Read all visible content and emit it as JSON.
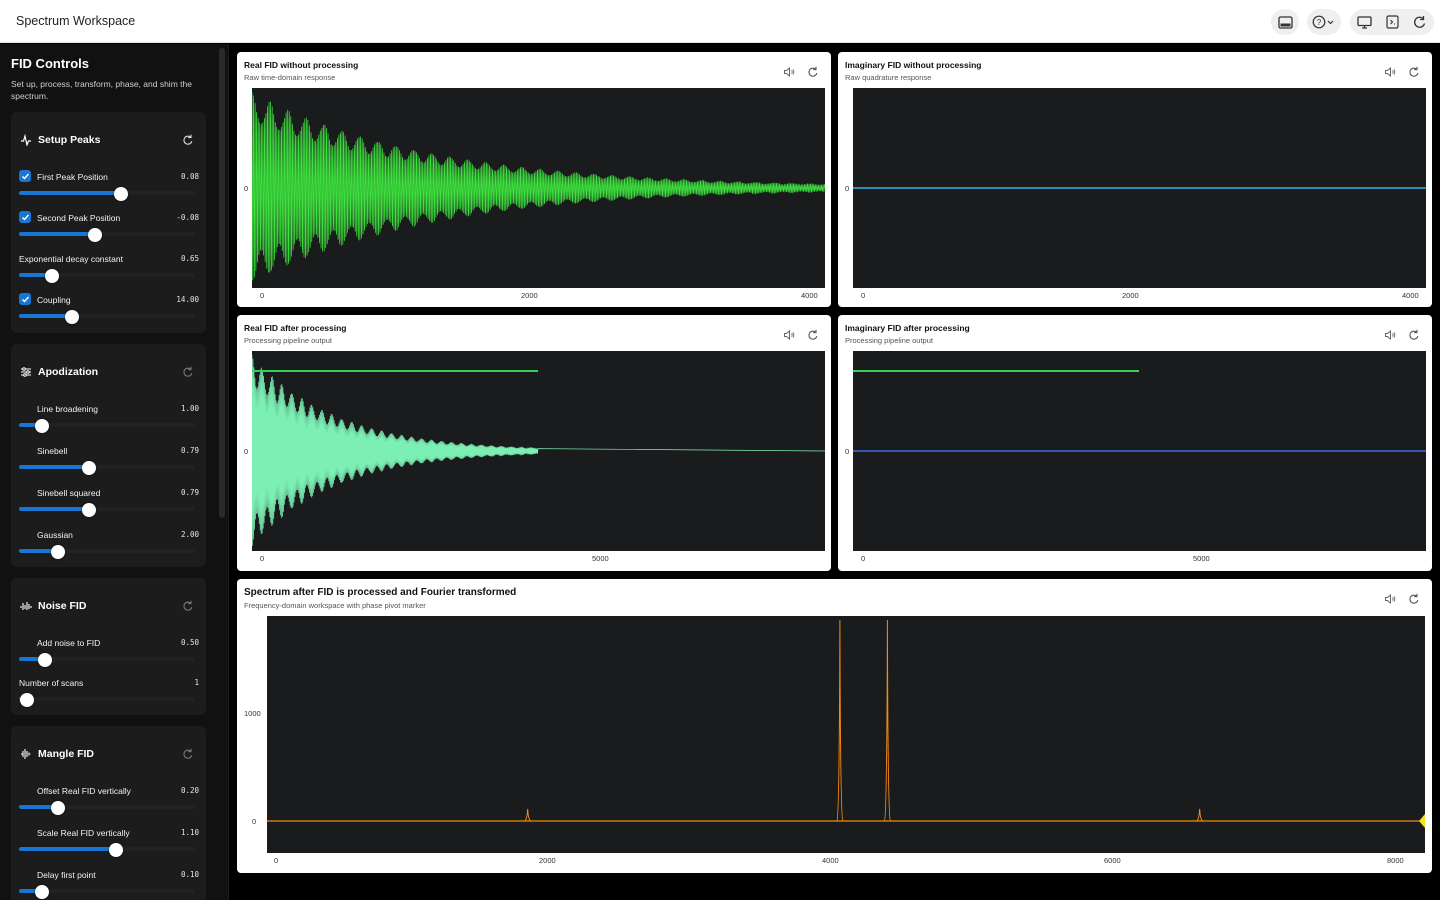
{
  "app": {
    "title": "Spectrum Workspace"
  },
  "toolbar": {
    "icons": [
      "panel-icon",
      "help-icon",
      "monitor-icon",
      "export-icon",
      "refresh-icon"
    ]
  },
  "sidebar": {
    "title": "FID Controls",
    "description": "Set up, process, transform, phase, and shim the spectrum.",
    "sections": [
      {
        "title": "Setup Peaks",
        "controls": [
          {
            "label": "First Peak Position",
            "value": "0.08",
            "checked": true,
            "level": 0.58
          },
          {
            "label": "Second Peak Position",
            "value": "-0.08",
            "checked": true,
            "level": 0.43
          },
          {
            "label": "Exponential decay constant",
            "value": "0.65",
            "level": 0.19
          },
          {
            "label": "Coupling",
            "value": "14.00",
            "checked": true,
            "level": 0.3
          }
        ]
      },
      {
        "title": "Apodization",
        "controls": [
          {
            "label": "Line broadening",
            "value": "1.00",
            "checked": false,
            "level": 0.13
          },
          {
            "label": "Sinebell",
            "value": "0.79",
            "checked": false,
            "level": 0.4
          },
          {
            "label": "Sinebell squared",
            "value": "0.79",
            "checked": false,
            "level": 0.4
          },
          {
            "label": "Gaussian",
            "value": "2.00",
            "checked": false,
            "level": 0.22
          }
        ]
      },
      {
        "title": "Noise FID",
        "controls": [
          {
            "label": "Add noise to FID",
            "value": "0.50",
            "checked": false,
            "level": 0.15
          },
          {
            "label": "Number of scans",
            "value": "1",
            "level": 0.0
          }
        ]
      },
      {
        "title": "Mangle FID",
        "controls": [
          {
            "label": "Offset Real FID vertically",
            "value": "0.20",
            "checked": false,
            "level": 0.22
          },
          {
            "label": "Scale Real FID vertically",
            "value": "1.10",
            "checked": false,
            "level": 0.55
          },
          {
            "label": "Delay first point",
            "value": "0.10",
            "checked": false,
            "level": 0.13
          }
        ]
      }
    ]
  },
  "panels": {
    "real_raw": {
      "title": "Real FID without processing",
      "subtitle": "Raw time-domain response",
      "y_tick": "0",
      "x_ticks": [
        "0",
        "2000",
        "4000"
      ]
    },
    "imag_raw": {
      "title": "Imaginary FID without processing",
      "subtitle": "Raw quadrature response",
      "y_tick": "0",
      "x_ticks": [
        "0",
        "2000",
        "4000"
      ]
    },
    "real_proc": {
      "title": "Real FID after processing",
      "subtitle": "Processing pipeline output",
      "y_tick": "0",
      "x_ticks": [
        "0",
        "5000"
      ]
    },
    "imag_proc": {
      "title": "Imaginary FID after processing",
      "subtitle": "Processing pipeline output",
      "y_tick": "0",
      "x_ticks": [
        "0",
        "5000"
      ]
    },
    "spectrum": {
      "title": "Spectrum after FID is processed and Fourier transformed",
      "subtitle": "Frequency-domain workspace with phase pivot marker",
      "y_ticks": [
        "1000",
        "0"
      ],
      "x_ticks": [
        "0",
        "2000",
        "4000",
        "6000",
        "8000"
      ]
    }
  },
  "colors": {
    "real_raw": "#3ee23e",
    "imag_raw": "#35b4e0",
    "real_proc": "#7cf0b4",
    "window": "#34d058",
    "imag_proc": "#3d6fe0",
    "spectrum": "#f08a1a",
    "pivot": "#f7e017",
    "accent": "#1976d2"
  },
  "chart_data": [
    {
      "type": "line",
      "series": [
        {
          "values": "decaying oscillation"
        }
      ],
      "xlim": [
        0,
        4096
      ],
      "x_ticks": [
        0,
        2000,
        4000
      ]
    },
    {
      "type": "line",
      "series": [
        {
          "values": "flat at 0"
        }
      ],
      "xlim": [
        0,
        4096
      ],
      "x_ticks": [
        0,
        2000,
        4000
      ]
    },
    {
      "type": "line",
      "xlim": [
        0,
        8192
      ],
      "x_ticks": [
        0,
        5000
      ]
    },
    {
      "type": "line",
      "xlim": [
        0,
        8192
      ],
      "x_ticks": [
        0,
        5000
      ]
    },
    {
      "type": "line",
      "x_ticks": [
        0,
        2000,
        4000,
        6000,
        8000
      ],
      "y_ticks": [
        0,
        1000
      ],
      "peaks": [
        {
          "x": 1620,
          "y": 110
        },
        {
          "x": 3920,
          "y": 1820
        },
        {
          "x": 4270,
          "y": 1820
        },
        {
          "x": 6570,
          "y": 110
        }
      ]
    }
  ]
}
